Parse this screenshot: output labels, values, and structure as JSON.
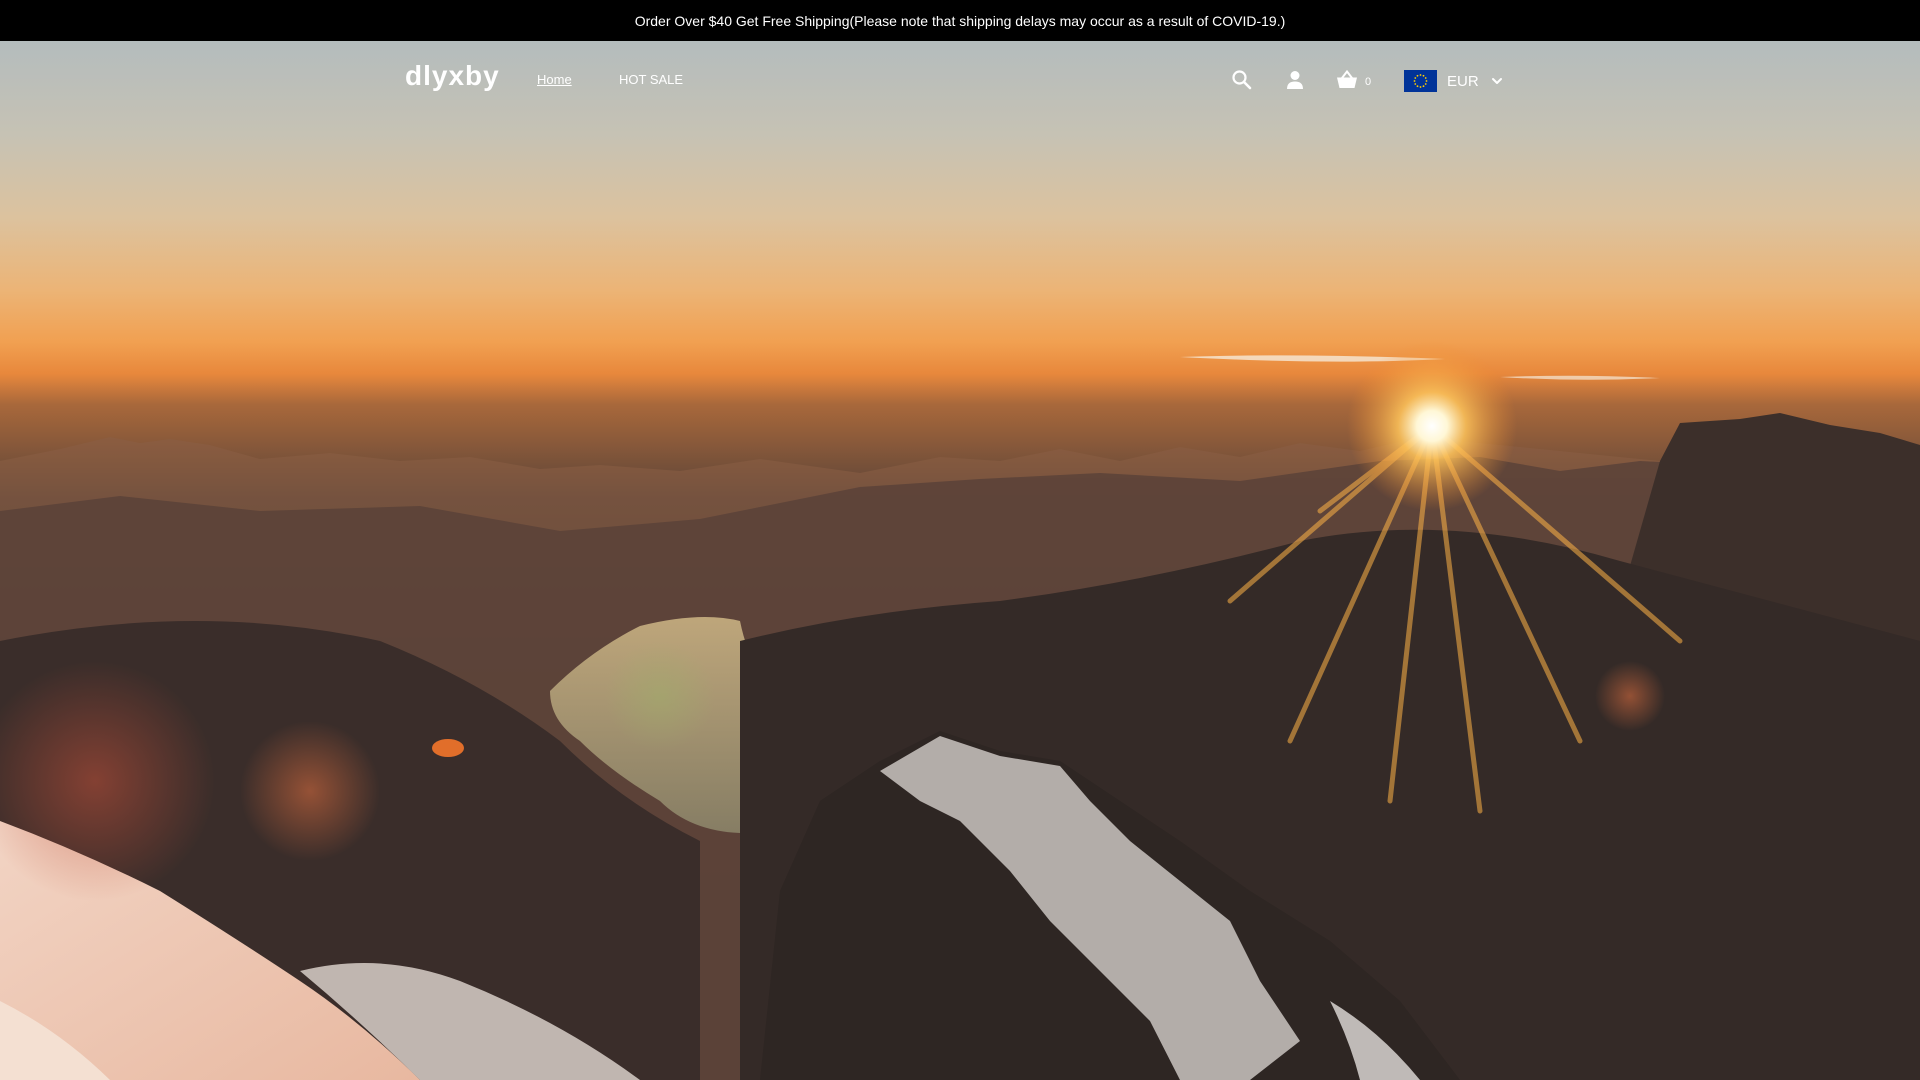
{
  "announcement": {
    "text": "Order Over $40 Get Free Shipping(Please note that shipping delays may occur as a result of COVID-19.)"
  },
  "header": {
    "logo": "dlyxby",
    "nav": [
      {
        "label": "Home",
        "active": true
      },
      {
        "label": "HOT SALE",
        "active": false
      }
    ],
    "icons": {
      "search": "search-icon",
      "account": "user-icon",
      "cart": "shopping-basket-icon",
      "currency_flag": "eu-flag-icon",
      "currency_dropdown": "chevron-down-icon"
    },
    "cart_count": "0",
    "currency": "EUR"
  },
  "hero": {
    "image": "sunset over alpine mountains with lake"
  },
  "colors": {
    "announcement_bg": "#000000",
    "header_text": "#ffffff",
    "eu_flag_blue": "#003399",
    "eu_flag_star": "#ffcc00"
  }
}
